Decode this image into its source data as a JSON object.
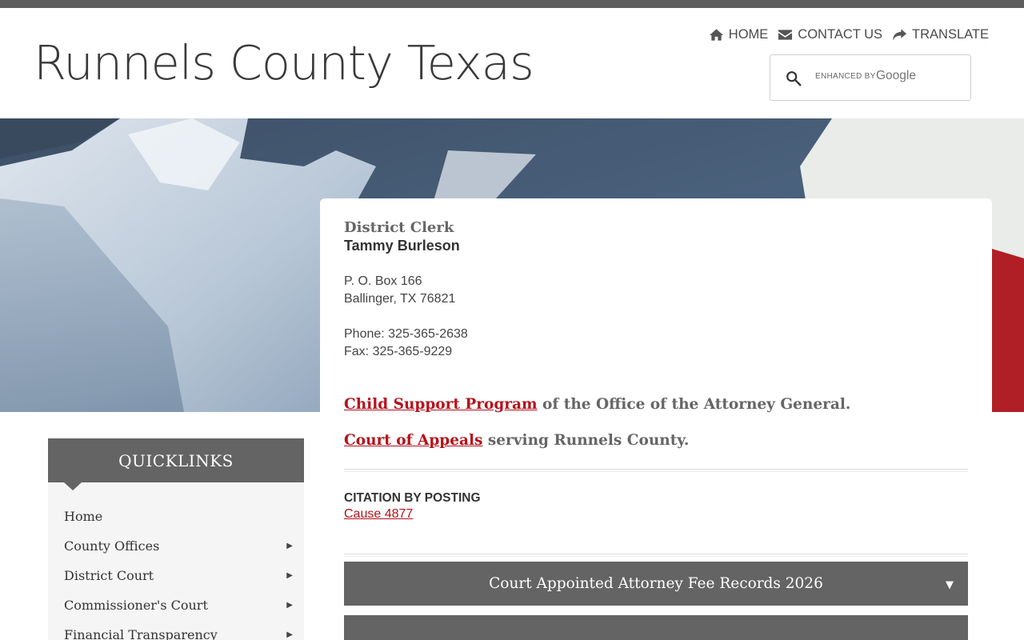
{
  "site": {
    "title": "Runnels County Texas"
  },
  "topnav": {
    "items": [
      {
        "label": "HOME",
        "icon": "home-icon"
      },
      {
        "label": "CONTACT US",
        "icon": "envelope-icon"
      },
      {
        "label": "TRANSLATE",
        "icon": "share-arrow-icon"
      }
    ]
  },
  "search": {
    "enhanced_by": "ENHANCED BY",
    "brand": "Google",
    "icon": "search-icon"
  },
  "colors": {
    "accent_red": "#b5121b",
    "panel_gray": "#646464",
    "top_bar": "#5e5e5e"
  },
  "content": {
    "department": "District Clerk",
    "clerk_name": "Tammy Burleson",
    "address_line1": "P. O. Box 166",
    "address_line2": "Ballinger, TX 76821",
    "phone": "Phone: 325-365-2638",
    "fax": "Fax: 325-365-9229",
    "child_support_link": "Child Support Program",
    "child_support_suffix": " of the Office of the Attorney General.",
    "appeals_link": "Court of Appeals",
    "appeals_suffix": " serving Runnels County.",
    "citation_heading": "CITATION BY POSTING",
    "citation_link": "Cause 4877",
    "accordion_title": "Court Appointed Attorney Fee Records 2026",
    "accordion_arrow": "▼"
  },
  "quicklinks": {
    "title": "QUICKLINKS",
    "items": [
      {
        "label": "Home",
        "has_submenu": false
      },
      {
        "label": "County Offices",
        "has_submenu": true
      },
      {
        "label": "District Court",
        "has_submenu": true
      },
      {
        "label": "Commissioner's Court",
        "has_submenu": true
      },
      {
        "label": "Financial Transparency",
        "has_submenu": true
      }
    ],
    "chevron": "▶"
  }
}
